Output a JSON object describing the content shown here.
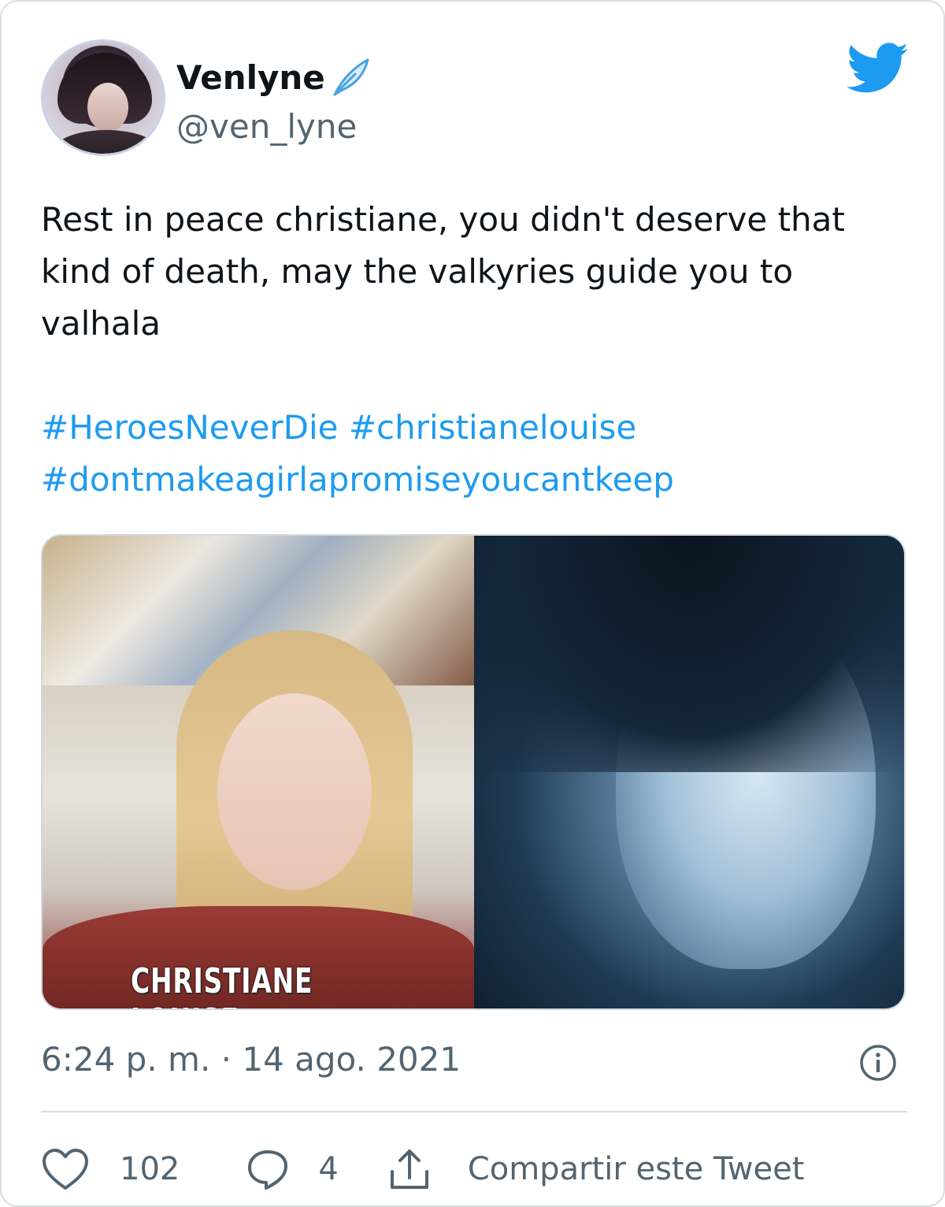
{
  "user": {
    "display_name": "Venlyne",
    "handle": "@ven_lyne",
    "badge_icon": "feather-icon"
  },
  "brand": {
    "logo": "twitter-bird-icon",
    "accent_color": "#1d9bf0"
  },
  "tweet": {
    "text": "Rest in peace christiane, you didn't deserve that kind of death, may the valkyries guide you to valhala",
    "hashtags": [
      "#HeroesNeverDie",
      "#christianelouise",
      "#dontmakeagirlapromiseyoucantkeep"
    ],
    "media_caption": "CHRISTIANE LOUISE",
    "timestamp": "6:24 p. m. · 14 ago. 2021"
  },
  "actions": {
    "likes": "102",
    "replies": "4",
    "share_label": "Compartir este Tweet"
  }
}
